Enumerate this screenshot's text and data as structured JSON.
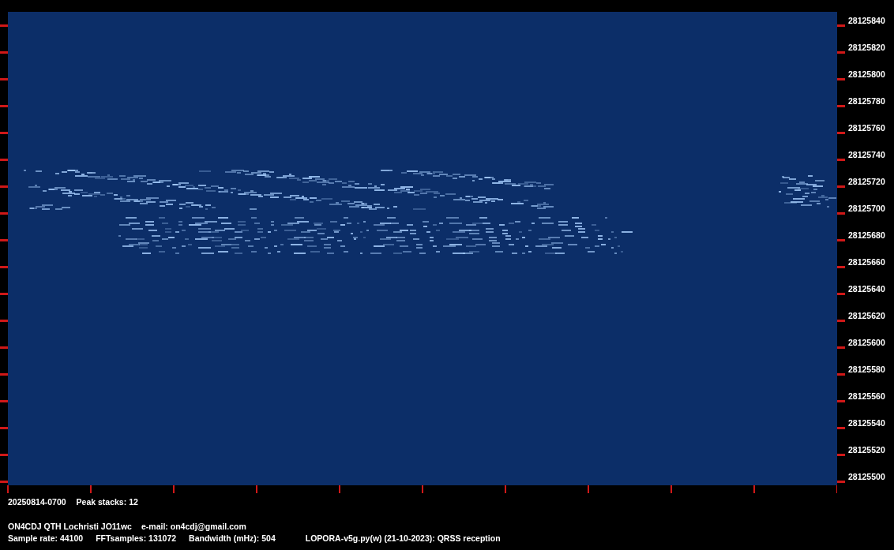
{
  "frequency_axis": {
    "labels": [
      "28125840",
      "28125820",
      "28125800",
      "28125780",
      "28125760",
      "28125740",
      "28125720",
      "28125700",
      "28125680",
      "28125660",
      "28125640",
      "28125620",
      "28125600",
      "28125580",
      "28125560",
      "28125540",
      "28125520",
      "28125500"
    ]
  },
  "footer": {
    "line_1": [
      "20250814-0700",
      "Peak stacks: 12"
    ],
    "line_2": [
      "ON4CDJ QTH Lochristi JO11wc",
      "e-mail: on4cdj@gmail.com"
    ],
    "line_3": [
      "Sample rate: 44100",
      "FFTsamples: 131072",
      "Bandwidth (mHz): 504",
      "LOPORA-v5g.py(w) (21-10-2023): QRSS reception"
    ]
  }
}
